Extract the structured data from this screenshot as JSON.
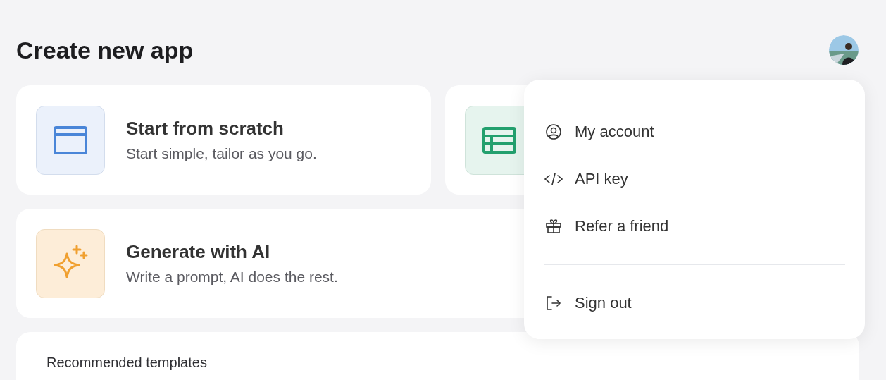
{
  "page": {
    "title": "Create new app"
  },
  "cards": [
    {
      "kind": "blank",
      "title": "Start from scratch",
      "subtitle": "Start simple, tailor as you go."
    },
    {
      "kind": "table"
    },
    {
      "kind": "ai",
      "title": "Generate with AI",
      "subtitle": "Write a prompt, AI does the rest."
    }
  ],
  "templates": {
    "heading": "Recommended templates"
  },
  "account_menu": {
    "groups": [
      [
        {
          "kind": "account",
          "label": "My account"
        },
        {
          "kind": "code",
          "label": "API key"
        },
        {
          "kind": "gift",
          "label": "Refer a friend"
        }
      ],
      [
        {
          "kind": "signout",
          "label": "Sign out"
        }
      ]
    ]
  }
}
